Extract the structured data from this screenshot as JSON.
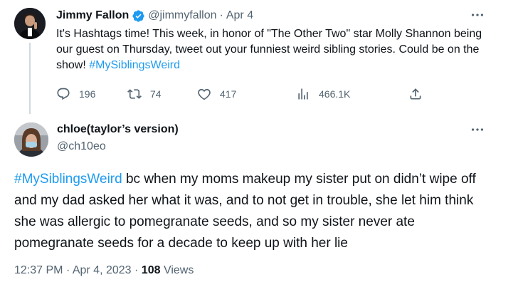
{
  "parent_tweet": {
    "author_name": "Jimmy Fallon",
    "author_handle": "@jimmyfallon",
    "separator": "·",
    "date": "Apr 4",
    "verified_icon": "verified-badge-icon",
    "text_prefix": "It's Hashtags time! This week, in honor of \"The Other Two\" star Molly Shannon being our guest on Thursday, tweet out your funniest weird sibling stories. Could be on the show! ",
    "hashtag": "#MySiblingsWeird",
    "actions": {
      "replies": "196",
      "retweets": "74",
      "likes": "417",
      "views": "466.1K"
    }
  },
  "reply_tweet": {
    "author_name": "chloe(taylor’s version)",
    "author_handle": "@ch10eo",
    "hashtag": "#MySiblingsWeird",
    "text_body": " bc when my moms makeup my sister put on didn’t wipe off and my dad asked her what it was, and to not get in trouble, she let him think she was allergic to pomegranate seeds, and so my sister never ate pomegranate seeds for a decade to keep up with her lie",
    "time": "12:37 PM",
    "separator": "·",
    "date": "Apr 4, 2023",
    "views_count": "108",
    "views_label": "Views"
  },
  "colors": {
    "accent": "#1d9bf0",
    "text_primary": "#0f1419",
    "text_secondary": "#536471",
    "thread_line": "#cfd9de"
  }
}
